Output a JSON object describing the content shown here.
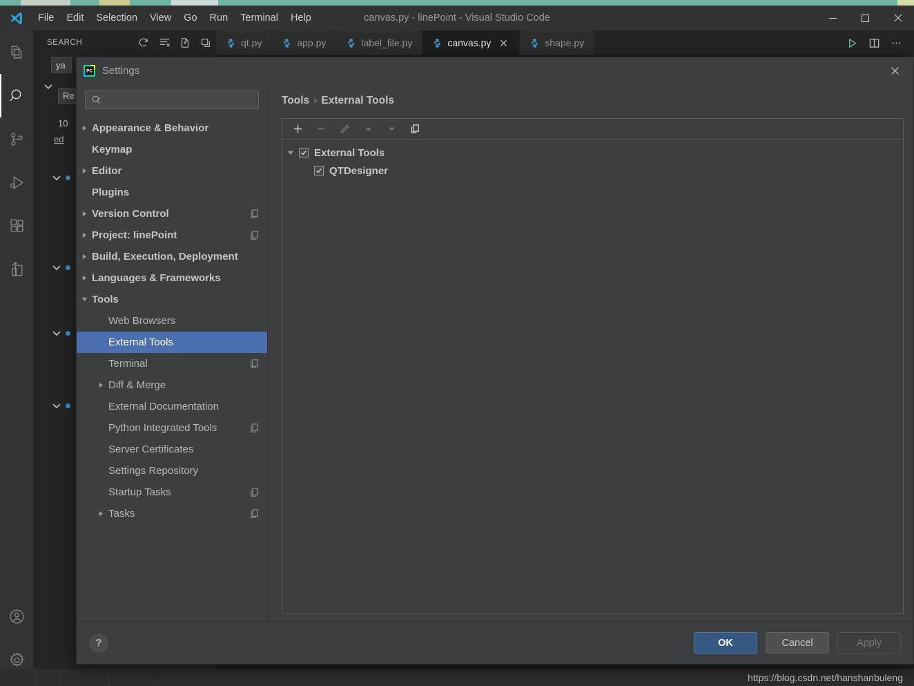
{
  "window": {
    "title": "canvas.py - linePoint - Visual Studio Code",
    "menu": [
      "File",
      "Edit",
      "Selection",
      "View",
      "Go",
      "Run",
      "Terminal",
      "Help"
    ],
    "controls": {
      "minimize": "minimize-icon",
      "maximize": "maximize-icon",
      "close": "close-icon"
    }
  },
  "activitybar": {
    "items": [
      {
        "name": "explorer",
        "icon": "files-icon",
        "active": false
      },
      {
        "name": "search",
        "icon": "search-icon",
        "active": true
      },
      {
        "name": "source-control",
        "icon": "source-control-icon",
        "active": false
      },
      {
        "name": "run-debug",
        "icon": "run-debug-icon",
        "active": false
      },
      {
        "name": "extensions",
        "icon": "extensions-icon",
        "active": false
      },
      {
        "name": "remote-explorer",
        "icon": "remote-explorer-icon",
        "active": false
      }
    ],
    "bottom": [
      {
        "name": "accounts",
        "icon": "account-icon"
      },
      {
        "name": "manage",
        "icon": "gear-icon"
      }
    ]
  },
  "sidebar": {
    "title": "SEARCH",
    "actions": [
      {
        "name": "refresh",
        "icon": "refresh-icon"
      },
      {
        "name": "clear-search-results",
        "icon": "clear-all-icon"
      },
      {
        "name": "open-new-search-editor",
        "icon": "new-editor-icon"
      },
      {
        "name": "collapse-all",
        "icon": "collapse-all-icon"
      }
    ],
    "results": [
      {
        "text": "ya",
        "kind": "file-chip"
      },
      {
        "text": "Re",
        "kind": "file-chip"
      },
      {
        "text": "10",
        "kind": "count"
      },
      {
        "text": "ed",
        "kind": "link"
      }
    ]
  },
  "editor": {
    "tabs": [
      {
        "label": "qt.py",
        "icon": "python-icon",
        "active": false,
        "closable": false
      },
      {
        "label": "app.py",
        "icon": "python-icon",
        "active": false,
        "closable": false
      },
      {
        "label": "label_file.py",
        "icon": "python-icon",
        "active": false,
        "closable": false
      },
      {
        "label": "canvas.py",
        "icon": "python-icon",
        "active": true,
        "closable": true
      },
      {
        "label": "shape.py",
        "icon": "python-icon",
        "active": false,
        "closable": false
      }
    ],
    "actions": [
      {
        "name": "run-python-file",
        "icon": "run-icon"
      },
      {
        "name": "split-editor",
        "icon": "split-editor-icon"
      },
      {
        "name": "more-actions",
        "icon": "ellipsis-icon"
      }
    ]
  },
  "statusbar": {
    "watermark": "https://blog.csdn.net/hanshanbuleng"
  },
  "settings_dialog": {
    "title": "Settings",
    "app_icon": "pycharm-icon",
    "close_icon": "close-icon",
    "search": {
      "value": "",
      "placeholder": "",
      "icon": "search-dropdown-icon"
    },
    "tree": [
      {
        "label": "Appearance & Behavior",
        "arrow": "collapsed",
        "indent": 0,
        "bold": true,
        "copy": false,
        "selected": false
      },
      {
        "label": "Keymap",
        "arrow": "none",
        "indent": 0,
        "bold": true,
        "copy": false,
        "selected": false
      },
      {
        "label": "Editor",
        "arrow": "collapsed",
        "indent": 0,
        "bold": true,
        "copy": false,
        "selected": false
      },
      {
        "label": "Plugins",
        "arrow": "none",
        "indent": 0,
        "bold": true,
        "copy": false,
        "selected": false
      },
      {
        "label": "Version Control",
        "arrow": "collapsed",
        "indent": 0,
        "bold": true,
        "copy": true,
        "selected": false
      },
      {
        "label": "Project: linePoint",
        "arrow": "collapsed",
        "indent": 0,
        "bold": true,
        "copy": true,
        "selected": false
      },
      {
        "label": "Build, Execution, Deployment",
        "arrow": "collapsed",
        "indent": 0,
        "bold": true,
        "copy": false,
        "selected": false
      },
      {
        "label": "Languages & Frameworks",
        "arrow": "collapsed",
        "indent": 0,
        "bold": true,
        "copy": false,
        "selected": false
      },
      {
        "label": "Tools",
        "arrow": "expanded",
        "indent": 0,
        "bold": true,
        "copy": false,
        "selected": false
      },
      {
        "label": "Web Browsers",
        "arrow": "none",
        "indent": 1,
        "bold": false,
        "copy": false,
        "selected": false
      },
      {
        "label": "External Tools",
        "arrow": "none",
        "indent": 1,
        "bold": false,
        "copy": false,
        "selected": true
      },
      {
        "label": "Terminal",
        "arrow": "none",
        "indent": 1,
        "bold": false,
        "copy": true,
        "selected": false
      },
      {
        "label": "Diff & Merge",
        "arrow": "collapsed",
        "indent": 1,
        "bold": false,
        "copy": false,
        "selected": false
      },
      {
        "label": "External Documentation",
        "arrow": "none",
        "indent": 1,
        "bold": false,
        "copy": false,
        "selected": false
      },
      {
        "label": "Python Integrated Tools",
        "arrow": "none",
        "indent": 1,
        "bold": false,
        "copy": true,
        "selected": false
      },
      {
        "label": "Server Certificates",
        "arrow": "none",
        "indent": 1,
        "bold": false,
        "copy": false,
        "selected": false
      },
      {
        "label": "Settings Repository",
        "arrow": "none",
        "indent": 1,
        "bold": false,
        "copy": false,
        "selected": false
      },
      {
        "label": "Startup Tasks",
        "arrow": "none",
        "indent": 1,
        "bold": false,
        "copy": true,
        "selected": false
      },
      {
        "label": "Tasks",
        "arrow": "collapsed",
        "indent": 1,
        "bold": false,
        "copy": true,
        "selected": false
      }
    ],
    "breadcrumb": {
      "parent": "Tools",
      "separator": "›",
      "current": "External Tools"
    },
    "toolbar": [
      {
        "name": "add-tool-button",
        "icon": "plus-icon",
        "enabled": true
      },
      {
        "name": "remove-tool-button",
        "icon": "minus-icon",
        "enabled": false
      },
      {
        "name": "edit-tool-button",
        "icon": "pencil-icon",
        "enabled": false
      },
      {
        "name": "move-up-button",
        "icon": "arrow-up-icon",
        "enabled": false
      },
      {
        "name": "move-down-button",
        "icon": "arrow-down-icon",
        "enabled": false
      },
      {
        "name": "copy-tool-button",
        "icon": "copy-icon",
        "enabled": true
      }
    ],
    "tools_tree": [
      {
        "label": "External Tools",
        "checked": true,
        "arrow": "expanded",
        "indent": 0
      },
      {
        "label": "QTDesigner",
        "checked": true,
        "arrow": "none",
        "indent": 1
      }
    ],
    "help_label": "?",
    "buttons": [
      {
        "label": "OK",
        "style": "primary",
        "name": "ok-button"
      },
      {
        "label": "Cancel",
        "style": "normal",
        "name": "cancel-button"
      },
      {
        "label": "Apply",
        "style": "disabled",
        "name": "apply-button"
      }
    ]
  },
  "colors": {
    "accent_selection": "#4b6eaf",
    "primary_button": "#365880",
    "dialog_bg": "#3c3f41",
    "vscode_bg": "#1e1e1e",
    "desktop": "#6fb5a6",
    "python_icon": "#3c8ec0"
  }
}
